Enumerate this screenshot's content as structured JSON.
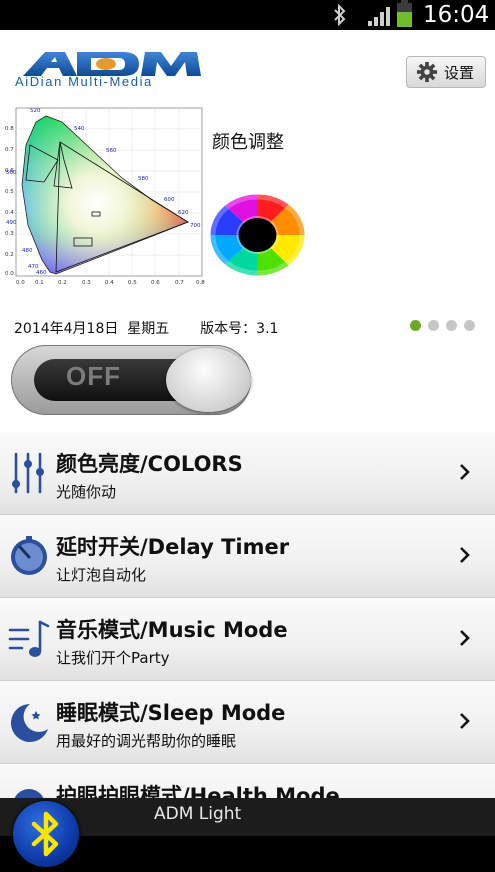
{
  "status_bar": {
    "time": "16:04"
  },
  "header": {
    "logo_text": "ADM",
    "logo_tagline": "AiDian Multi-Media",
    "settings_label": "设置"
  },
  "color_panel": {
    "title": "颜色调整"
  },
  "info": {
    "date": "2014年4月18日",
    "weekday": "星期五",
    "version_label": "版本号：3.1"
  },
  "pager": {
    "count": 4,
    "active": 0
  },
  "power_toggle": {
    "state_label": "OFF"
  },
  "menu": [
    {
      "title": "颜色亮度/COLORS",
      "subtitle": "光随你动",
      "icon": "sliders-icon"
    },
    {
      "title": "延时开关/Delay Timer",
      "subtitle": "让灯泡自动化",
      "icon": "timer-icon"
    },
    {
      "title": "音乐模式/Music Mode",
      "subtitle": "让我们开个Party",
      "icon": "music-icon"
    },
    {
      "title": "睡眠模式/Sleep Mode",
      "subtitle": "用最好的调光帮助你的睡眠",
      "icon": "moon-icon"
    },
    {
      "title": "护眼护眼模式/Health Mode",
      "subtitle": "",
      "icon": "eye-icon"
    }
  ],
  "bottom_bar": {
    "app_title": "ADM Light"
  },
  "colors": {
    "accent_green": "#6ea825",
    "logo_blue": "#1b5fa8",
    "icon_blue": "#2b4f9e"
  }
}
